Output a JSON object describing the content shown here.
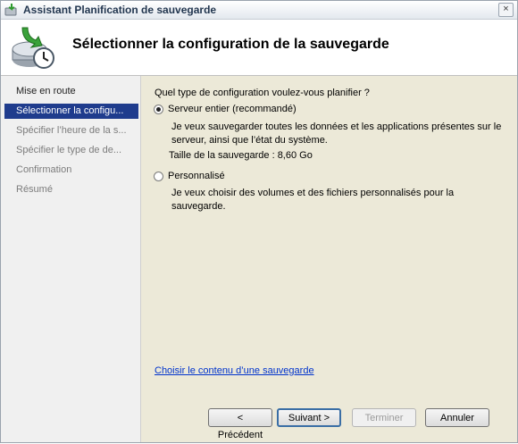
{
  "window": {
    "title": "Assistant Planification de sauvegarde",
    "close_label": "×"
  },
  "header": {
    "title": "Sélectionner la configuration de la sauvegarde"
  },
  "sidebar": {
    "items": [
      {
        "label": "Mise en route",
        "state": "done"
      },
      {
        "label": "Sélectionner la configu...",
        "state": "active"
      },
      {
        "label": "Spécifier l’heure de la s...",
        "state": "pending"
      },
      {
        "label": "Spécifier le type de de...",
        "state": "pending"
      },
      {
        "label": "Confirmation",
        "state": "pending"
      },
      {
        "label": "Résumé",
        "state": "pending"
      }
    ]
  },
  "main": {
    "question": "Quel type de configuration voulez-vous planifier ?",
    "options": [
      {
        "label": "Serveur entier (recommandé)",
        "checked": true,
        "description": "Je veux sauvegarder toutes les données et les applications présentes sur le serveur, ainsi que l’état du système.",
        "size_text": "Taille de la sauvegarde : 8,60 Go"
      },
      {
        "label": "Personnalisé",
        "checked": false,
        "description": "Je veux choisir des volumes et des fichiers personnalisés pour la sauvegarde."
      }
    ],
    "link": "Choisir le contenu d’une sauvegarde"
  },
  "buttons": {
    "previous": "< Précédent",
    "next": "Suivant >",
    "finish": "Terminer",
    "cancel": "Annuler"
  },
  "colors": {
    "active_item": "#1f3c8d",
    "link": "#0033cc"
  }
}
